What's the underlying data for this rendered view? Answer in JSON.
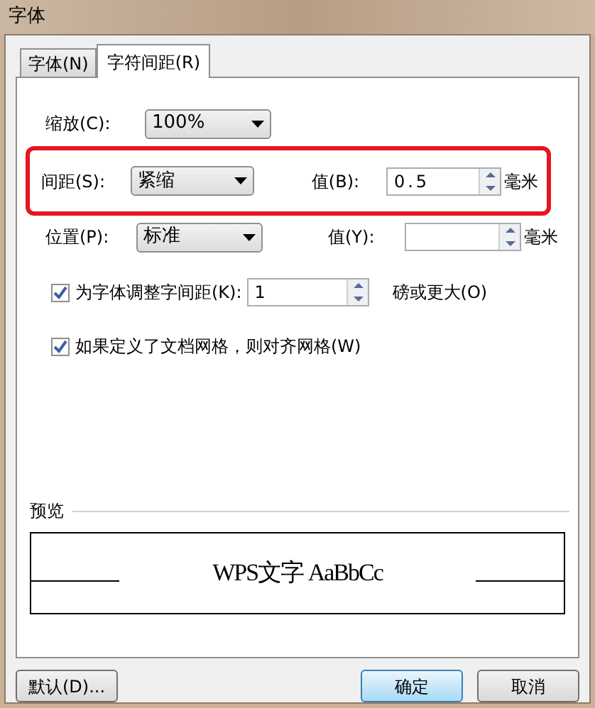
{
  "window": {
    "title": "字体"
  },
  "tabs": [
    {
      "label": "字体(N)",
      "selected": false
    },
    {
      "label": "字符间距(R)",
      "selected": true
    }
  ],
  "scale": {
    "label": "缩放(C):",
    "value": "100%"
  },
  "spacing": {
    "label": "间距(S):",
    "value": "紧缩",
    "value_label": "值(B):",
    "amount": "0.5",
    "unit": "毫米",
    "highlighted": true
  },
  "position": {
    "label": "位置(P):",
    "value": "标准",
    "value_label": "值(Y):",
    "unit": "毫米"
  },
  "checkboxes": [
    {
      "label": "为字体调整字间距(K):",
      "checked": true,
      "value": "1",
      "suffix": "磅或更大(O)"
    },
    {
      "label": "如果定义了文档网格，则对齐网格(W)",
      "checked": true
    }
  ],
  "preview": {
    "label": "预览",
    "sample": "WPS文字 AaBbCc"
  },
  "buttons": [
    {
      "label": "默认(D)...",
      "default": false
    },
    {
      "label": "确定",
      "default": true
    },
    {
      "label": "取消",
      "default": false
    }
  ]
}
